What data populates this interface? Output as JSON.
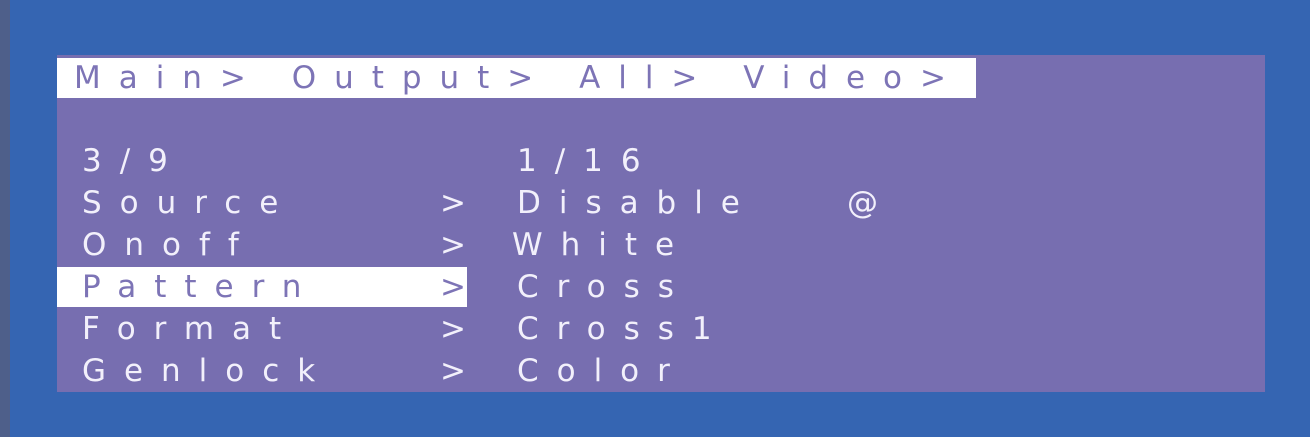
{
  "breadcrumb": "Main> Output> All> Video>",
  "menu": {
    "page_indicator": "3/9",
    "items": [
      {
        "label": "Source",
        "arrow": ">",
        "value": "Disable",
        "marker": "@"
      },
      {
        "label": "Onoff",
        "arrow": ">",
        "value": "White"
      },
      {
        "label": "Pattern",
        "arrow": ">",
        "value": "Cross",
        "selected": true
      },
      {
        "label": "Format",
        "arrow": ">",
        "value": "Cross1"
      },
      {
        "label": "Genlock",
        "arrow": ">",
        "value": "Color"
      }
    ]
  },
  "submenu": {
    "page_indicator": "1/16"
  },
  "colors": {
    "outer_background": "#3565b2",
    "screen_background": "#776eb0",
    "highlight_background": "#ffffff",
    "highlight_text": "#7d74b6",
    "text": "#f2f0fb"
  }
}
